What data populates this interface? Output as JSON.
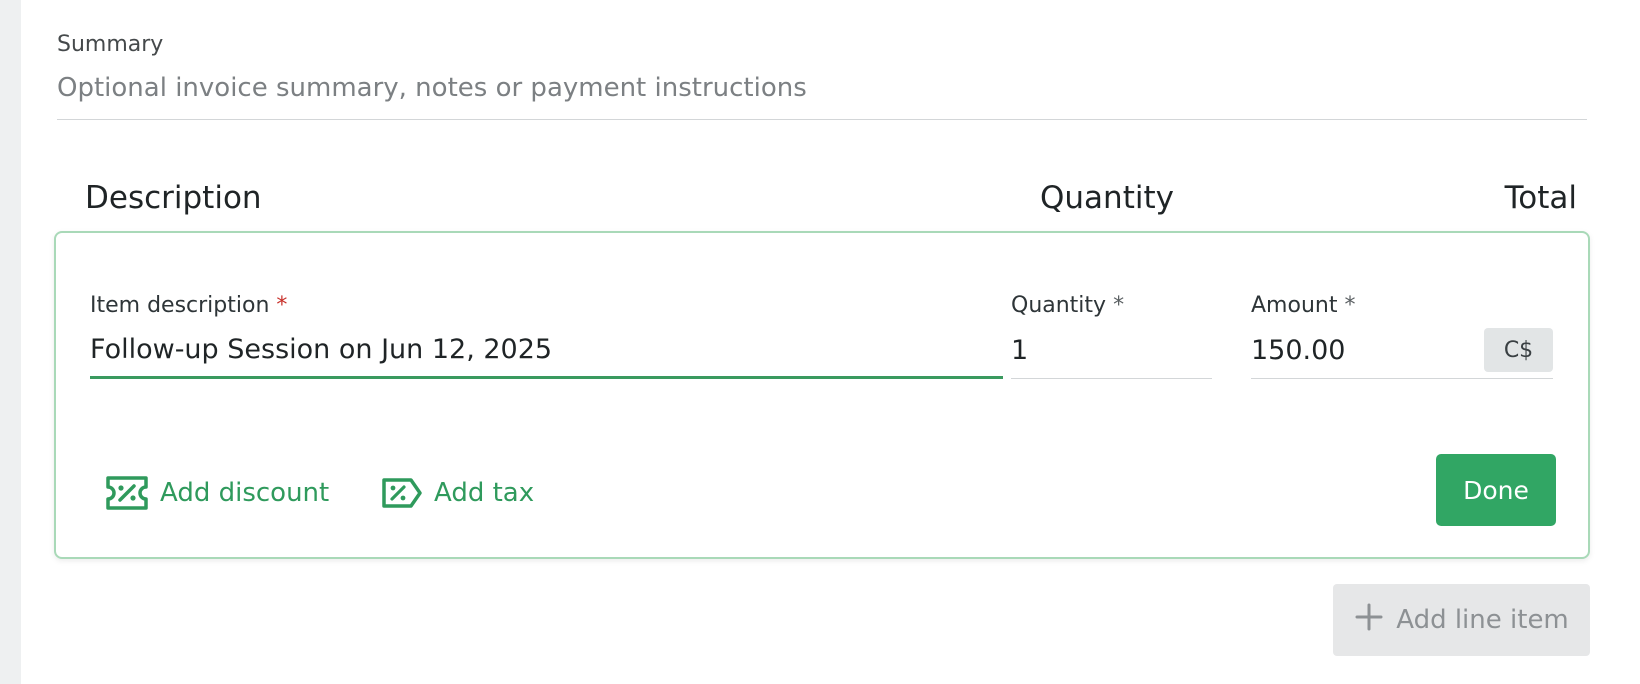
{
  "summary": {
    "label": "Summary",
    "placeholder": "Optional invoice summary, notes or payment instructions"
  },
  "columns": {
    "description": "Description",
    "quantity": "Quantity",
    "total": "Total"
  },
  "line_item_editor": {
    "item_description_label": "Item description",
    "item_description_value": "Follow-up Session on Jun 12, 2025",
    "quantity_label": "Quantity",
    "quantity_value": "1",
    "amount_label": "Amount",
    "amount_value": "150.00",
    "currency": "C$",
    "required_mark": "*",
    "add_discount_label": "Add discount",
    "add_tax_label": "Add tax",
    "done_label": "Done"
  },
  "add_line_item_label": "Add line item",
  "colors": {
    "accent_green": "#31a664",
    "link_green": "#2f9a5c",
    "required_red": "#c8302a",
    "disabled_grey": "#8d9194"
  }
}
